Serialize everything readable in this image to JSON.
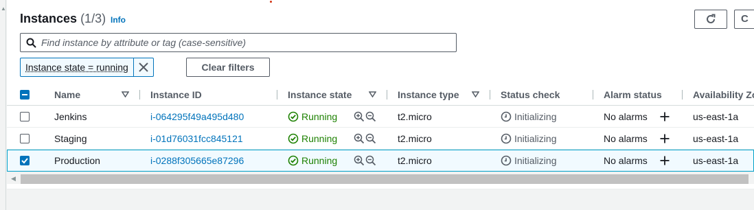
{
  "header": {
    "title": "Instances",
    "count": "(1/3)",
    "info_label": "Info",
    "next_button_label": "C"
  },
  "search": {
    "placeholder": "Find instance by attribute or tag (case-sensitive)",
    "value": ""
  },
  "filters": {
    "token_label": "Instance state = running",
    "clear_label": "Clear filters"
  },
  "table": {
    "columns": {
      "name": "Name",
      "instance_id": "Instance ID",
      "instance_state": "Instance state",
      "instance_type": "Instance type",
      "status_check": "Status check",
      "alarm_status": "Alarm status",
      "availability_zone": "Availability Zo"
    },
    "rows": [
      {
        "name": "Jenkins",
        "instance_id": "i-064295f49a495d480",
        "state": "Running",
        "type": "t2.micro",
        "status_check": "Initializing",
        "alarm": "No alarms",
        "az": "us-east-1a",
        "selected": false
      },
      {
        "name": "Staging",
        "instance_id": "i-01d76031fcc845121",
        "state": "Running",
        "type": "t2.micro",
        "status_check": "Initializing",
        "alarm": "No alarms",
        "az": "us-east-1a",
        "selected": false
      },
      {
        "name": "Production",
        "instance_id": "i-0288f305665e87296",
        "state": "Running",
        "type": "t2.micro",
        "status_check": "Initializing",
        "alarm": "No alarms",
        "az": "us-east-1a",
        "selected": true
      }
    ]
  },
  "colors": {
    "accent": "#0073bb",
    "running": "#1d8102",
    "selected_bg": "#f1faff"
  }
}
